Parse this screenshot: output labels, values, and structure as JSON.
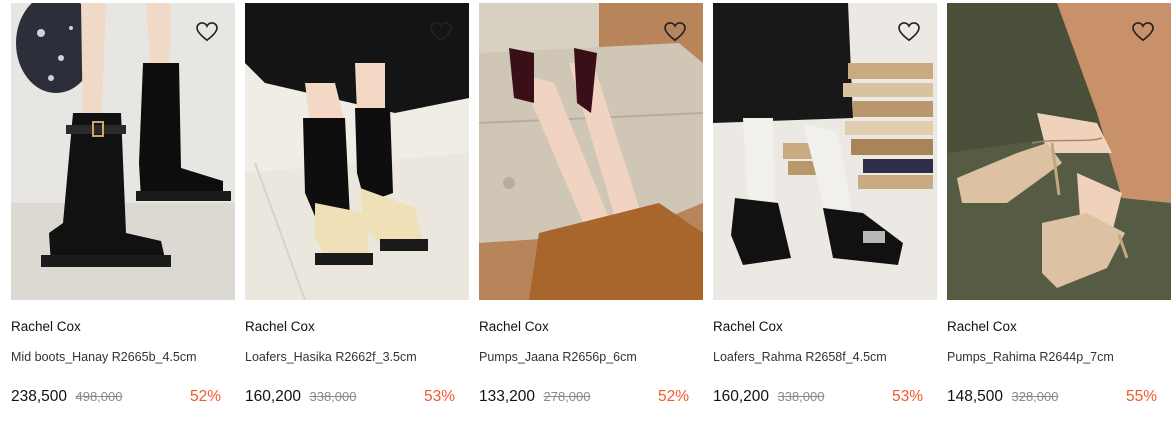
{
  "products": [
    {
      "brand": "Rachel Cox",
      "name": "Mid boots_Hanay R2665b_4.5cm",
      "price": "238,500",
      "original_price": "498,000",
      "discount": "52%",
      "photo": "black-mid-boots-photo"
    },
    {
      "brand": "Rachel Cox",
      "name": "Loafers_Hasika R2662f_3.5cm",
      "price": "160,200",
      "original_price": "338,000",
      "discount": "53%",
      "photo": "beige-loafers-photo"
    },
    {
      "brand": "Rachel Cox",
      "name": "Pumps_Jaana R2656p_6cm",
      "price": "133,200",
      "original_price": "278,000",
      "discount": "52%",
      "photo": "burgundy-pumps-photo"
    },
    {
      "brand": "Rachel Cox",
      "name": "Loafers_Rahma R2658f_4.5cm",
      "price": "160,200",
      "original_price": "338,000",
      "discount": "53%",
      "photo": "black-loafers-photo"
    },
    {
      "brand": "Rachel Cox",
      "name": "Pumps_Rahima R2644p_7cm",
      "price": "148,500",
      "original_price": "328,000",
      "discount": "55%",
      "photo": "nude-pumps-photo"
    }
  ],
  "colors": {
    "discount": "#ef5a2a",
    "original_price": "#8a8a8a"
  },
  "icons": {
    "wishlist": "heart-outline-icon"
  }
}
